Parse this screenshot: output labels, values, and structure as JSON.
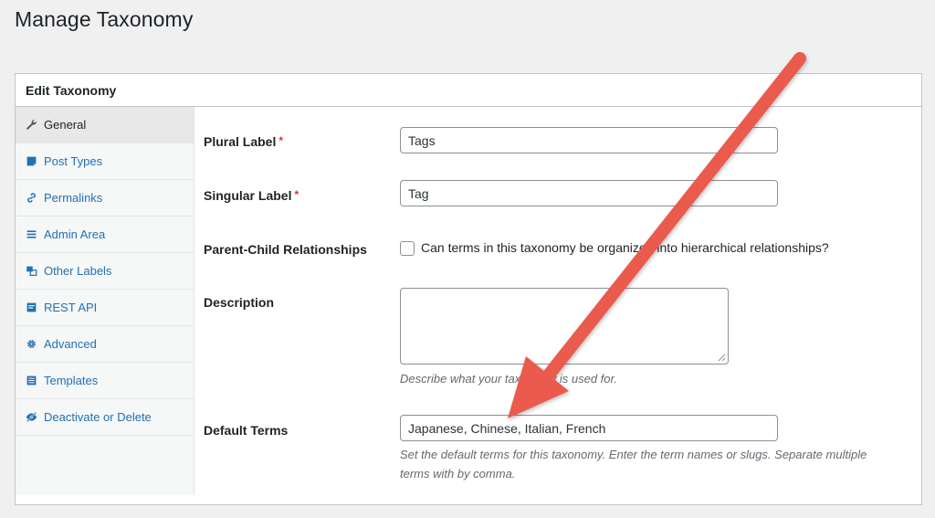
{
  "page": {
    "title": "Manage Taxonomy"
  },
  "panel": {
    "title": "Edit Taxonomy"
  },
  "sidebar": {
    "items": [
      {
        "label": "General",
        "icon": "wrench-icon"
      },
      {
        "label": "Post Types",
        "icon": "post-icon"
      },
      {
        "label": "Permalinks",
        "icon": "link-icon"
      },
      {
        "label": "Admin Area",
        "icon": "menu-icon"
      },
      {
        "label": "Other Labels",
        "icon": "labels-icon"
      },
      {
        "label": "REST API",
        "icon": "api-icon"
      },
      {
        "label": "Advanced",
        "icon": "gear-icon"
      },
      {
        "label": "Templates",
        "icon": "list-icon"
      },
      {
        "label": "Deactivate or Delete",
        "icon": "hidden-icon"
      }
    ],
    "active": "General"
  },
  "form": {
    "plural_label": {
      "label": "Plural Label",
      "required": "*",
      "value": "Tags"
    },
    "singular_label": {
      "label": "Singular Label",
      "required": "*",
      "value": "Tag"
    },
    "parent_child": {
      "label": "Parent-Child Relationships",
      "checkbox_text": "Can terms in this taxonomy be organized into hierarchical relationships?",
      "checked": false
    },
    "description": {
      "label": "Description",
      "value": "",
      "help": "Describe what your taxonomy is used for."
    },
    "default_terms": {
      "label": "Default Terms",
      "value": "Japanese, Chinese, Italian, French",
      "help": "Set the default terms for this taxonomy. Enter the term names or slugs. Separate multiple terms with by comma."
    }
  },
  "colors": {
    "accent": "#2271b1",
    "arrow": "#ea5a4e",
    "required": "#d63638"
  }
}
